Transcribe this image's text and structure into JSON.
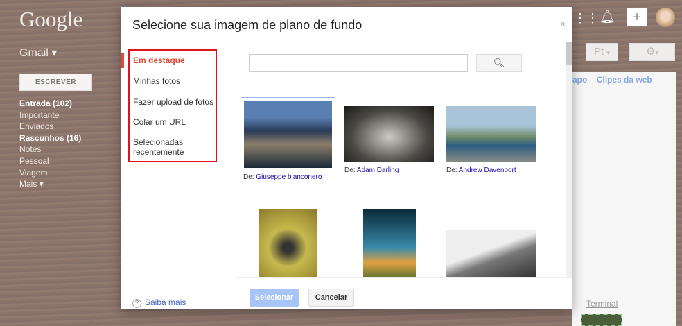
{
  "app": {
    "logo": "Google",
    "product": "Gmail ▾",
    "compose": "ESCREVER",
    "labels": [
      {
        "label": "Entrada (102)",
        "bold": true
      },
      {
        "label": "Importante"
      },
      {
        "label": "Enviados"
      },
      {
        "label": "Rascunhos (16)",
        "bold": true
      },
      {
        "label": "Notes"
      },
      {
        "label": "Pessoal"
      },
      {
        "label": "Viagem"
      },
      {
        "label": "Mais ▾"
      }
    ],
    "lang": "Pt",
    "tabs_partial": "apo",
    "clips": "Clipes da web",
    "terminal": "Terminal"
  },
  "dialog": {
    "title": "Selecione sua imagem de plano de fundo",
    "close": "×",
    "nav": [
      "Em destaque",
      "Minhas fotos",
      "Fazer upload de fotos",
      "Colar um URL",
      "Selecionadas recentemente"
    ],
    "search": {
      "value": "",
      "placeholder": ""
    },
    "by": "De:",
    "images": [
      {
        "author": "Giuseppe bianconero",
        "selected": true
      },
      {
        "author": "Adam Darling"
      },
      {
        "author": "Andrew Davenport"
      },
      {
        "author": ""
      },
      {
        "author": ""
      },
      {
        "author": ""
      }
    ],
    "select": "Selecionar",
    "cancel": "Cancelar",
    "help": "Saiba mais"
  }
}
